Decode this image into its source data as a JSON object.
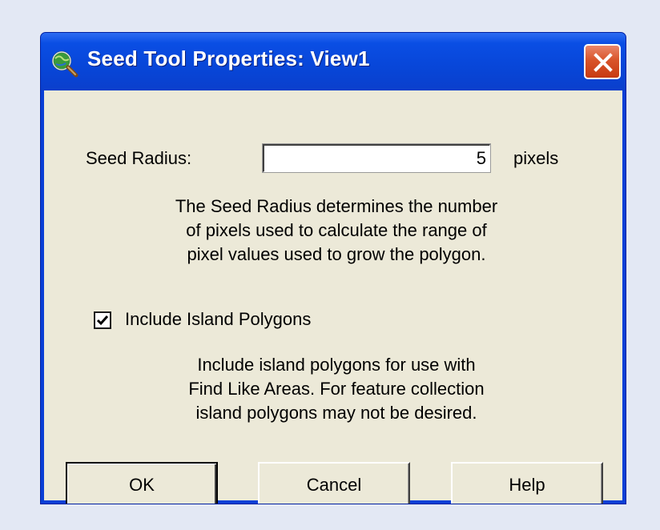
{
  "window": {
    "title": "Seed Tool Properties: View1",
    "icon": "magnifier-globe-icon"
  },
  "seed_radius": {
    "label": "Seed Radius:",
    "value": "5",
    "unit": "pixels",
    "description": "The Seed Radius determines the number\nof pixels used to calculate the range of\npixel values used to grow the polygon."
  },
  "island": {
    "checkbox_label": "Include Island Polygons",
    "checked": true,
    "description": "Include island polygons for use with\nFind Like Areas.  For feature collection\nisland polygons may not be desired."
  },
  "buttons": {
    "ok": "OK",
    "cancel": "Cancel",
    "help": "Help"
  },
  "colors": {
    "titlebar": "#0a4ee4",
    "close": "#d9542a",
    "dialog_face": "#ece9d8",
    "page_background": "#e3e8f4"
  }
}
